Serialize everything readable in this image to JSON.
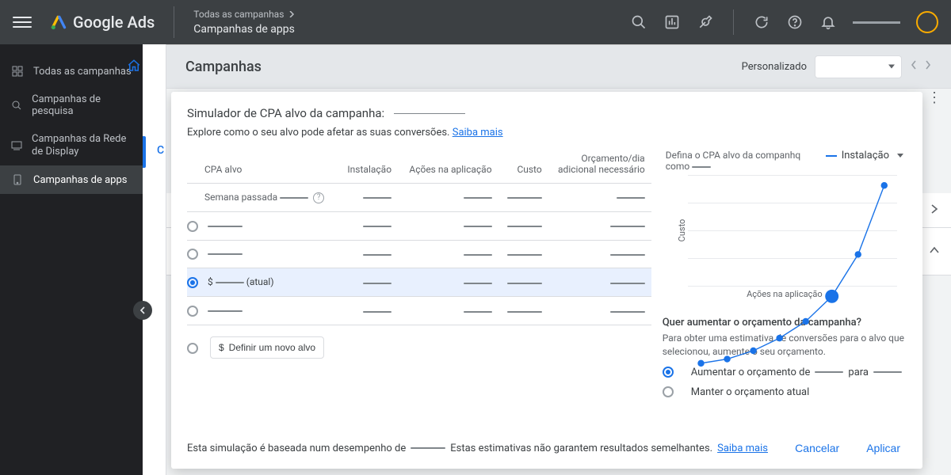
{
  "header": {
    "product": "Google Ads",
    "breadcrumb_top": "Todas as campanhas",
    "breadcrumb_bottom": "Campanhas de apps"
  },
  "sidebar": {
    "items": [
      {
        "label": "Todas as campanhas"
      },
      {
        "label": "Campanhas de pesquisa"
      },
      {
        "label": "Campanhas da Rede de Display"
      },
      {
        "label": "Campanhas de apps"
      }
    ]
  },
  "toolbar": {
    "title": "Campanhas",
    "date_label": "Personalizado"
  },
  "dialog": {
    "title": "Simulador de CPA alvo da campanha:",
    "subtitle": "Explore como o seu alvo pode afetar as suas conversões.",
    "learn_more": "Saiba mais",
    "columns": {
      "cpa": "CPA alvo",
      "install": "Instalação",
      "inapp": "Ações na aplicação",
      "cost": "Custo",
      "budget": "Orçamento/dia adicional necessário"
    },
    "last_week": "Semana passada",
    "current_suffix": "(atual)",
    "currency": "$",
    "new_target_btn": "Definir um novo alvo",
    "right": {
      "define_prefix": "Defina o CPA alvo da companhq como",
      "legend": "Instalação",
      "y_label": "Custo",
      "x_label": "Ações na aplicação",
      "budget_q": "Quer aumentar o orçamento da campanha?",
      "budget_sub": "Para obter uma estimativa de conversões para o alvo que selecionou, aumente o seu orçamento.",
      "opt_increase_prefix": "Aumentar o orçamento de",
      "opt_increase_mid": "para",
      "opt_keep": "Manter o orçamento atual"
    },
    "footer": {
      "pre": "Esta simulação é baseada num desempenho de",
      "post": "Estas estimativas não garantem resultados semelhantes.",
      "learn_more": "Saiba mais",
      "cancel": "Cancelar",
      "apply": "Aplicar"
    }
  },
  "chart_data": {
    "type": "line",
    "title": "",
    "xlabel": "Ações na aplicação",
    "ylabel": "Custo",
    "series": [
      {
        "name": "Instalação",
        "x": [
          1,
          2,
          3,
          4,
          5,
          6,
          7,
          8
        ],
        "y": [
          10,
          12,
          16,
          22,
          30,
          42,
          62,
          95
        ]
      }
    ],
    "highlight_index": 5,
    "ylim": [
      0,
      100
    ],
    "xlim": [
      0.5,
      8.5
    ]
  }
}
